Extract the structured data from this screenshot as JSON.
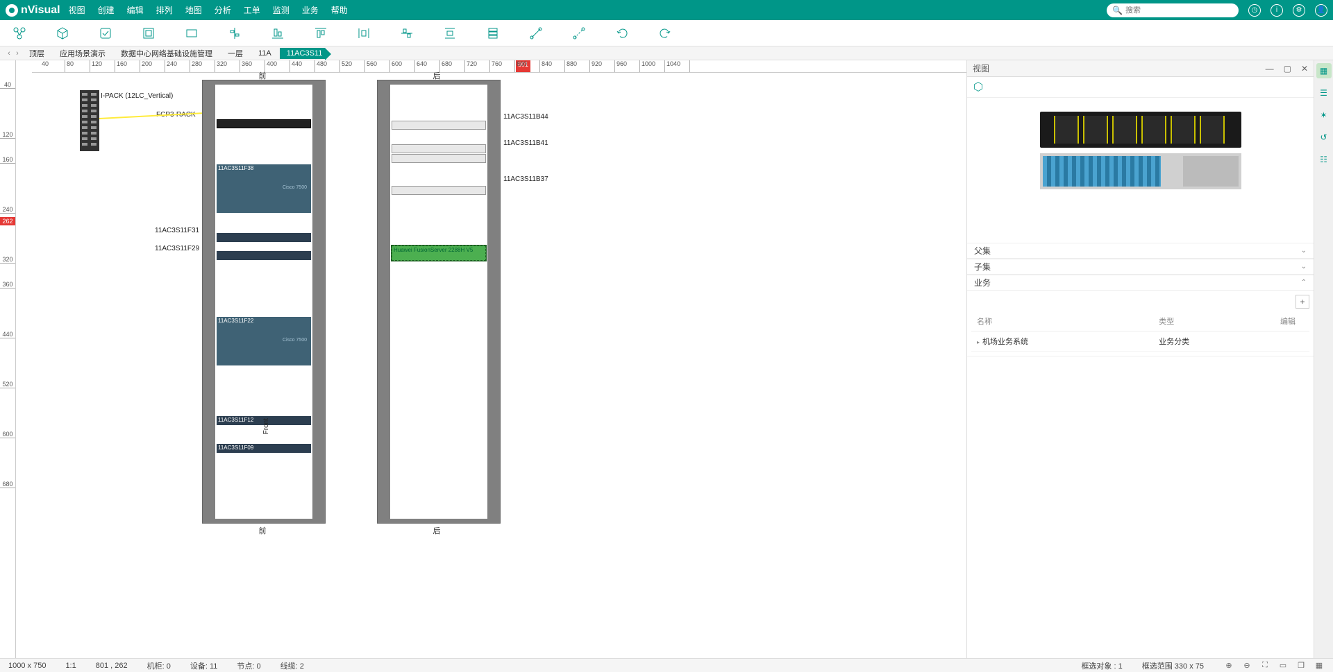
{
  "app": {
    "name": "nVisual"
  },
  "menu": [
    "视图",
    "创建",
    "编辑",
    "排列",
    "地图",
    "分析",
    "工单",
    "监测",
    "业务",
    "帮助"
  ],
  "search": {
    "placeholder": "搜索"
  },
  "breadcrumbs": [
    "顶层",
    "应用场景演示",
    "数据中心网络基础设施管理",
    "一层",
    "11A",
    "11AC3S11"
  ],
  "ruler_h": [
    "40",
    "80",
    "120",
    "160",
    "200",
    "240",
    "280",
    "320",
    "360",
    "400",
    "440",
    "480",
    "520",
    "560",
    "600",
    "640",
    "680",
    "720",
    "760",
    "800",
    "840",
    "880",
    "920",
    "960",
    "1000",
    "1040"
  ],
  "ruler_h_marker": "801",
  "ruler_v": [
    "40",
    "120",
    "160",
    "240",
    "320",
    "360",
    "440",
    "520",
    "600",
    "680"
  ],
  "ruler_v_marker": "262",
  "racks": {
    "front": {
      "label": "前",
      "bottom_label": "前"
    },
    "back": {
      "label": "后",
      "bottom_label": "后"
    }
  },
  "side_patch_label": "I-PACK (12LC_Vertical)",
  "fcp_label": "FCP3-RACK",
  "front_devices": {
    "f38": "11AC3S11F38",
    "f31": "11AC3S11F31",
    "f29": "11AC3S11F29",
    "f22": "11AC3S11F22",
    "f12": "11AC3S11F12",
    "f09": "11AC3S11F09",
    "cisco": "Cisco 7500"
  },
  "back_devices": {
    "b44": "11AC3S11B44",
    "b41": "11AC3S11B41",
    "b37": "11AC3S11B37",
    "server": "Huawei FusionServer 2288H V5"
  },
  "vertical_text": "Front",
  "props": {
    "title": "视图",
    "accordions": {
      "a1": "父集",
      "a2": "子集",
      "a3": "业务"
    },
    "columns": {
      "c1": "名称",
      "c2": "类型",
      "c3": "编辑"
    },
    "row": {
      "name": "机场业务系统",
      "type": "业务分类"
    }
  },
  "status": {
    "size": "1000 x 750",
    "zoom": "1:1",
    "cursor": "801 , 262",
    "rack": "机柜: 0",
    "device": "设备: 11",
    "node": "节点: 0",
    "cable": "线缆: 2",
    "sel_obj": "框选对象 : 1",
    "sel_range": "框选范围 330 x 75"
  }
}
